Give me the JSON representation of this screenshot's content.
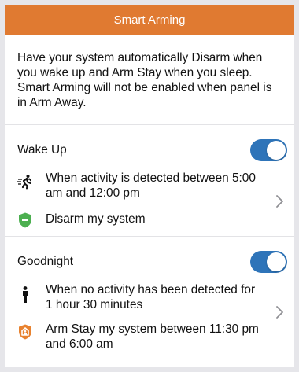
{
  "header": {
    "title": "Smart Arming"
  },
  "description": "Have your system automatically Disarm when you wake up and Arm Stay when you sleep. Smart Arming will not be enabled when panel is in Arm Away.",
  "wake_up": {
    "title": "Wake Up",
    "enabled": true,
    "activity_text": "When activity is detected between 5:00 am and 12:00 pm",
    "action_text": "Disarm my system",
    "activity_icon": "running-person-icon",
    "action_icon": "shield-disarm-icon"
  },
  "goodnight": {
    "title": "Goodnight",
    "enabled": true,
    "activity_text": "When no activity has been detected for 1 hour 30 minutes",
    "action_text": "Arm Stay my system between 11:30 pm and 6:00 am",
    "activity_icon": "standing-person-icon",
    "action_icon": "shield-arm-stay-icon"
  },
  "colors": {
    "header": "#e07a31",
    "toggle_on": "#2e74b9",
    "disarm_green": "#4caf50",
    "arm_stay_orange": "#e8822f"
  }
}
